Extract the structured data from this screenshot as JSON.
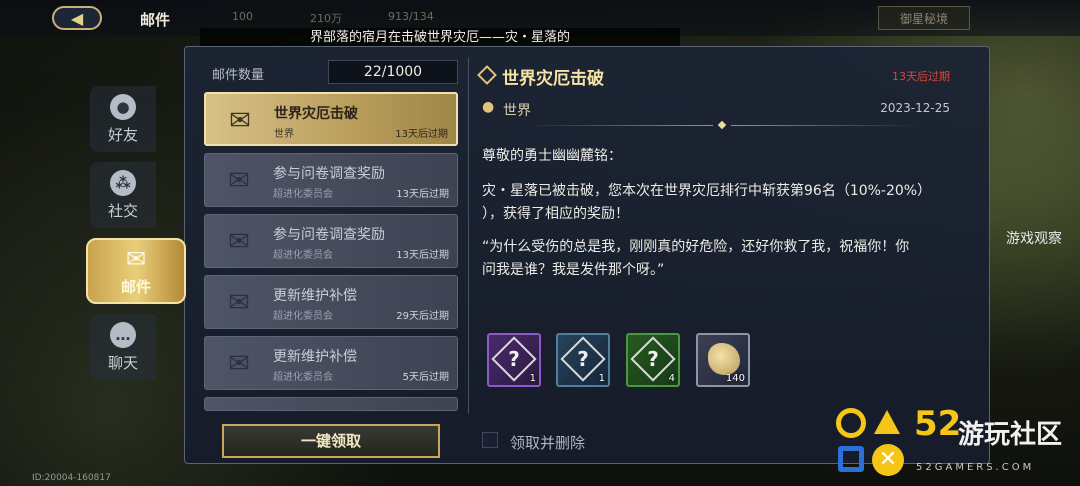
{
  "topbar": {
    "title": "邮件",
    "res1": "100",
    "res2": "210万",
    "res3": "913/134",
    "right_btn": "御星秘境",
    "marquee": "界部落的宿月在击破世界灾厄——灾・星落的"
  },
  "sidebar": {
    "items": [
      {
        "label": "好友",
        "icon": "friend-icon"
      },
      {
        "label": "社交",
        "icon": "social-icon"
      },
      {
        "label": "邮件",
        "icon": "mail-icon"
      },
      {
        "label": "聊天",
        "icon": "chat-icon"
      }
    ]
  },
  "mail_list": {
    "count_label": "邮件数量",
    "count_value": "22/1000",
    "items": [
      {
        "title": "世界灾厄击破",
        "from": "世界",
        "expires": "13天后过期"
      },
      {
        "title": "参与问卷调查奖励",
        "from": "超进化委员会",
        "expires": "13天后过期"
      },
      {
        "title": "参与问卷调查奖励",
        "from": "超进化委员会",
        "expires": "13天后过期"
      },
      {
        "title": "更新维护补偿",
        "from": "超进化委员会",
        "expires": "29天后过期"
      },
      {
        "title": "更新维护补偿",
        "from": "超进化委员会",
        "expires": "5天后过期"
      }
    ],
    "claim_all": "一键领取"
  },
  "detail": {
    "title": "世界灾厄击破",
    "expires": "13天后过期",
    "from": "世界",
    "date": "2023-12-25",
    "greeting": "尊敬的勇士幽幽麓铭：",
    "para1": "灾・星落已被击破，您本次在世界灾厄排行中斩获第96名（10%-20%）",
    "para1b": "），获得了相应的奖励！",
    "para2": "“为什么受伤的总是我，刚刚真的好危险，还好你救了我，祝福你！你",
    "para2b": "问我是谁？我是发件那个呀。”",
    "rewards": [
      {
        "count": "1",
        "color": "#8a5bc8"
      },
      {
        "count": "1",
        "color": "#4f7f9e"
      },
      {
        "count": "4",
        "color": "#4a9a3c"
      },
      {
        "count": "140",
        "color": "#d8c07a"
      }
    ],
    "delete_label": "领取并删除"
  },
  "footer": {
    "id": "ID:20004-160817"
  },
  "watermark": {
    "num": "52",
    "text": "游玩社区",
    "sub": "52GAMERS.COM",
    "observe": "游戏观察"
  }
}
